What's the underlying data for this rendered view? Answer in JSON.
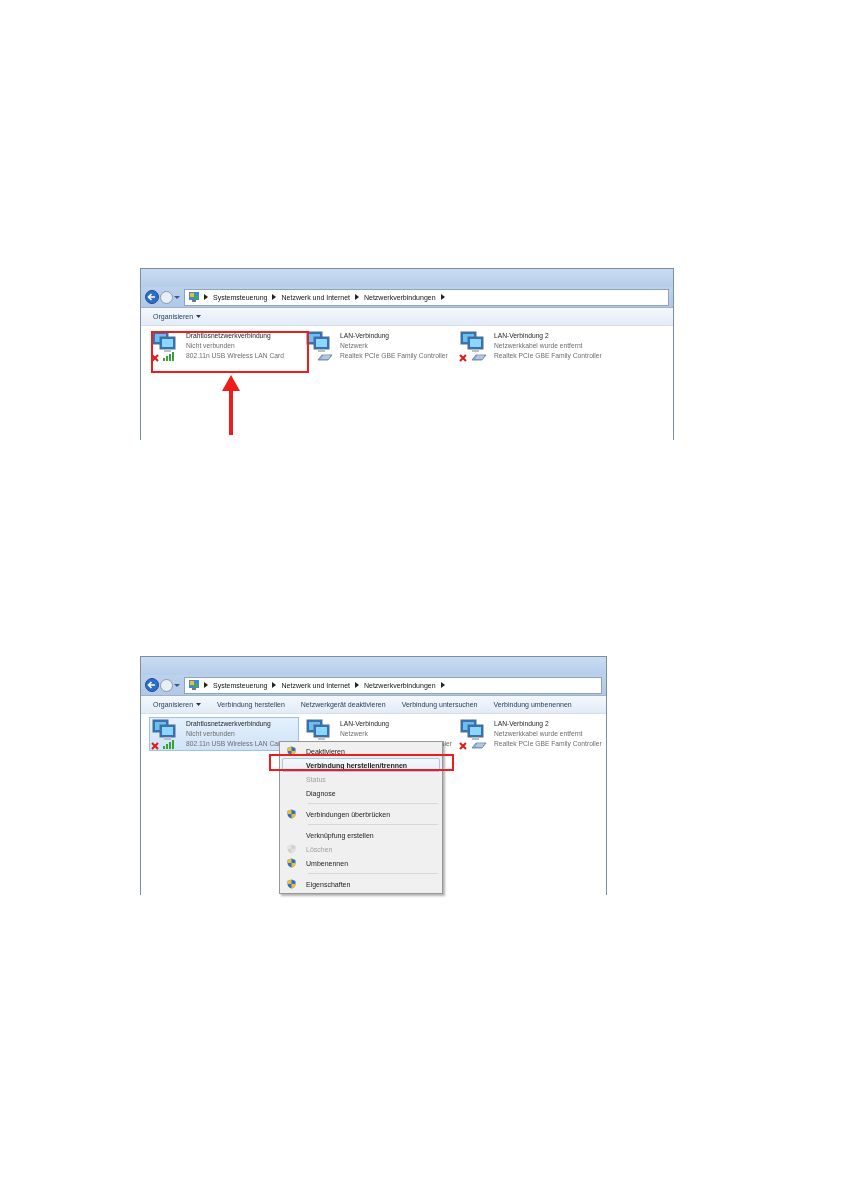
{
  "screenshots": [
    {
      "breadcrumb": [
        "Systemsteuerung",
        "Netzwerk und Internet",
        "Netzwerkverbindungen"
      ],
      "commands": [
        {
          "label": "Organisieren",
          "dropdown": true
        }
      ],
      "connections": [
        {
          "name": "Drahtlosnetzwerkverbindung",
          "status": "Nicht verbunden",
          "device": "802.11n USB Wireless LAN Card",
          "kind": "wireless",
          "error": true,
          "selected": false,
          "annotated": true
        },
        {
          "name": "LAN-Verbindung",
          "status": "Netzwerk",
          "device": "Realtek PCIe GBE Family Controller",
          "kind": "wired",
          "error": false,
          "selected": false
        },
        {
          "name": "LAN-Verbindung 2",
          "status": "Netzwerkkabel wurde entfernt",
          "device": "Realtek PCIe GBE Family Controller",
          "kind": "wired",
          "error": true,
          "selected": false
        }
      ]
    },
    {
      "breadcrumb": [
        "Systemsteuerung",
        "Netzwerk und Internet",
        "Netzwerkverbindungen"
      ],
      "commands": [
        {
          "label": "Organisieren",
          "dropdown": true
        },
        {
          "label": "Verbindung herstellen",
          "dropdown": false
        },
        {
          "label": "Netzwerkgerät deaktivieren",
          "dropdown": false
        },
        {
          "label": "Verbindung untersuchen",
          "dropdown": false
        },
        {
          "label": "Verbindung umbenennen",
          "dropdown": false
        }
      ],
      "connections": [
        {
          "name": "Drahtlosnetzwerkverbindung",
          "status": "Nicht verbunden",
          "device": "802.11n USB Wireless LAN Car",
          "kind": "wireless",
          "error": true,
          "selected": true
        },
        {
          "name": "LAN-Verbindung",
          "status": "Netzwerk",
          "device": "ller",
          "device_covered": true,
          "kind": "wired",
          "error": false,
          "selected": false
        },
        {
          "name": "LAN-Verbindung 2",
          "status": "Netzwerkkabel wurde entfernt",
          "device": "Realtek PCIe GBE Family Controller",
          "kind": "wired",
          "error": true,
          "selected": false
        }
      ],
      "context_menu": [
        {
          "kind": "item",
          "label": "Deaktivieren",
          "icon": true,
          "disabled": false,
          "default": false,
          "selected": false
        },
        {
          "kind": "item",
          "label": "Verbindung herstellen/trennen",
          "icon": false,
          "disabled": false,
          "default": true,
          "selected": true,
          "annotated": true
        },
        {
          "kind": "item",
          "label": "Status",
          "icon": false,
          "disabled": true,
          "default": false,
          "selected": false
        },
        {
          "kind": "item",
          "label": "Diagnose",
          "icon": false,
          "disabled": false,
          "default": false,
          "selected": false
        },
        {
          "kind": "separator"
        },
        {
          "kind": "item",
          "label": "Verbindungen überbrücken",
          "icon": true,
          "disabled": false,
          "default": false,
          "selected": false
        },
        {
          "kind": "separator"
        },
        {
          "kind": "item",
          "label": "Verknüpfung erstellen",
          "icon": false,
          "disabled": false,
          "default": false,
          "selected": false
        },
        {
          "kind": "item",
          "label": "Löschen",
          "icon": true,
          "disabled": true,
          "default": false,
          "selected": false
        },
        {
          "kind": "item",
          "label": "Umbenennen",
          "icon": true,
          "disabled": false,
          "default": false,
          "selected": false
        },
        {
          "kind": "separator"
        },
        {
          "kind": "item",
          "label": "Eigenschaften",
          "icon": true,
          "disabled": false,
          "default": false,
          "selected": false
        }
      ]
    }
  ]
}
